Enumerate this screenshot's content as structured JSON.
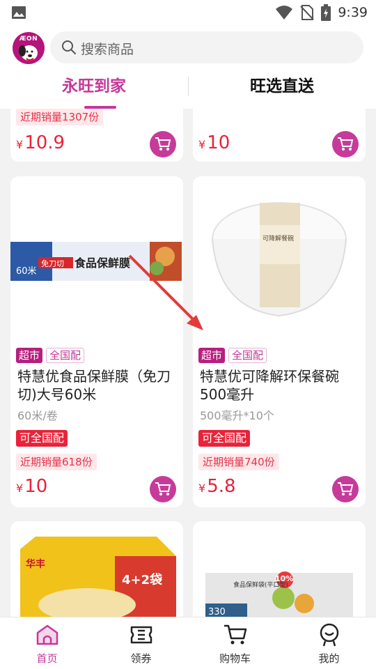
{
  "status_bar": {
    "time": "9:39"
  },
  "header": {
    "logo_text": "ÆON",
    "search_placeholder": "搜索商品",
    "tabs": [
      {
        "label": "永旺到家",
        "active": true
      },
      {
        "label": "旺选直送",
        "active": false
      }
    ]
  },
  "top_partial": [
    {
      "sales": "近期销量1307份",
      "price": "10.9",
      "currency": "¥"
    },
    {
      "price": "10",
      "currency": "¥"
    }
  ],
  "products": [
    {
      "tags": [
        "超市",
        "全国配"
      ],
      "name": "特慧优食品保鲜膜（免刀切)大号60米",
      "spec": "60米/卷",
      "badge": "可全国配",
      "sales": "近期销量618份",
      "currency": "¥",
      "price": "10",
      "image": "cling-film-box"
    },
    {
      "tags": [
        "超市",
        "全国配"
      ],
      "name": "特慧优可降解环保餐碗500毫升",
      "spec": "500毫升*10个",
      "badge": "可全国配",
      "sales": "近期销量740份",
      "currency": "¥",
      "price": "5.8",
      "image": "paper-bowl-pack"
    }
  ],
  "package_text": {
    "film_box_title": "食品保鲜膜",
    "film_box_size": "60米",
    "film_box_cut": "免刀切",
    "bowl_label": "可降解餐碗",
    "noodle_brand": "华丰",
    "noodle_promo": "4+2袋",
    "bag_label": "食品保鲜袋(平口型)",
    "bag_count": "330",
    "bag_badge": "10%"
  },
  "bottom_nav": [
    {
      "label": "首页",
      "icon": "home-icon",
      "active": true
    },
    {
      "label": "领券",
      "icon": "coupon-icon",
      "active": false
    },
    {
      "label": "购物车",
      "icon": "cart-icon",
      "active": false
    },
    {
      "label": "我的",
      "icon": "profile-icon",
      "active": false
    }
  ],
  "colors": {
    "brand": "#c4389a",
    "price_red": "#e8233a",
    "cart_button": "#c63b9a"
  }
}
